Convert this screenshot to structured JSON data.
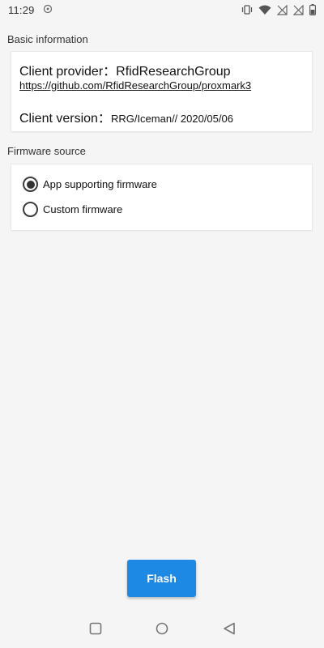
{
  "status_bar": {
    "time": "11:29",
    "icons": [
      "notification-icon",
      "vibrate-icon",
      "wifi-icon",
      "no-signal-icon",
      "no-signal-icon",
      "battery-icon"
    ]
  },
  "basic_info": {
    "section_title": "Basic information",
    "provider_label": "Client provider：",
    "provider_value": "RfidResearchGroup",
    "provider_link": "https://github.com/RfidResearchGroup/proxmark3",
    "version_label": "Client version：",
    "version_value": "RRG/Iceman// 2020/05/06"
  },
  "firmware_source": {
    "section_title": "Firmware source",
    "options": [
      {
        "label": "App supporting firmware",
        "selected": true
      },
      {
        "label": "Custom firmware",
        "selected": false
      }
    ]
  },
  "actions": {
    "flash_label": "Flash"
  },
  "nav_bar": {
    "buttons": [
      "recent-apps-icon",
      "home-icon",
      "back-icon"
    ]
  },
  "colors": {
    "accent": "#1e88e5",
    "background": "#f5f5f5",
    "card": "#ffffff"
  }
}
